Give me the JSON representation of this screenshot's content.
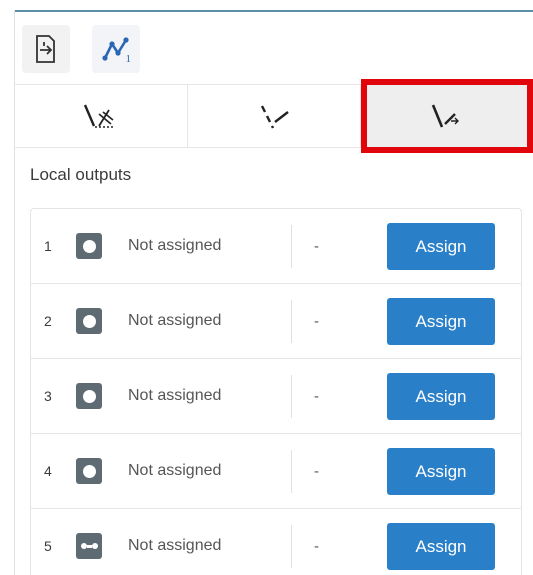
{
  "toolbar": {
    "buttons": [
      {
        "icon": "export-icon"
      },
      {
        "icon": "chart-line-icon",
        "subscript": "1"
      }
    ]
  },
  "tabs": [
    {
      "icon": "axis-cross-icon"
    },
    {
      "icon": "dash-slash-icon"
    },
    {
      "icon": "slash-arrow-icon"
    }
  ],
  "section": {
    "title": "Local outputs"
  },
  "outputs": [
    {
      "number": "1",
      "icon": "output-dot-icon",
      "status": "Not assigned",
      "value": "-",
      "action": "Assign"
    },
    {
      "number": "2",
      "icon": "output-dot-icon",
      "status": "Not assigned",
      "value": "-",
      "action": "Assign"
    },
    {
      "number": "3",
      "icon": "output-dot-icon",
      "status": "Not assigned",
      "value": "-",
      "action": "Assign"
    },
    {
      "number": "4",
      "icon": "output-dot-icon",
      "status": "Not assigned",
      "value": "-",
      "action": "Assign"
    },
    {
      "number": "5",
      "icon": "output-link-icon",
      "status": "Not assigned",
      "value": "-",
      "action": "Assign"
    }
  ],
  "colors": {
    "accent": "#2a7fc9",
    "highlight": "#e0060b",
    "icon_bg": "#5e6b73",
    "top_line": "#5a8fa7"
  }
}
